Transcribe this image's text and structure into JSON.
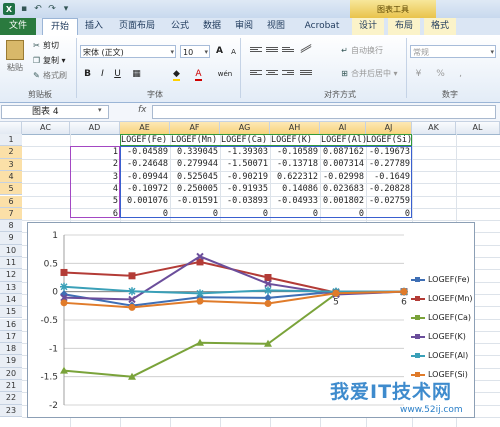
{
  "app": {
    "title_bar": {
      "logo": "X",
      "context_tab_title": "图表工具"
    },
    "tabs": [
      {
        "label": "文件"
      },
      {
        "label": "开始"
      },
      {
        "label": "插入"
      },
      {
        "label": "页面布局"
      },
      {
        "label": "公式"
      },
      {
        "label": "数据"
      },
      {
        "label": "审阅"
      },
      {
        "label": "视图"
      },
      {
        "label": "Acrobat"
      },
      {
        "label": "设计"
      },
      {
        "label": "布局"
      },
      {
        "label": "格式"
      }
    ]
  },
  "ribbon": {
    "clipboard": {
      "paste": "粘贴",
      "cut": "剪切",
      "copy": "复制 ▾",
      "format_painter": "格式刷",
      "group_label": "剪贴板"
    },
    "font": {
      "font_name": "宋体 (正文)",
      "font_size": "10",
      "grow": "A",
      "shrink": "A",
      "bold": "B",
      "italic": "I",
      "underline": "U",
      "wen": "wén",
      "group_label": "字体"
    },
    "alignment": {
      "wrap": "自动换行",
      "merge": "合并后居中 ▾",
      "group_label": "对齐方式"
    },
    "number": {
      "format": "常规",
      "group_label": "数字"
    }
  },
  "formula_bar": {
    "name_box": "图表 4",
    "fx": "fx",
    "value": ""
  },
  "columns": [
    "AC",
    "AD",
    "AE",
    "AF",
    "AG",
    "AH",
    "AI",
    "AJ",
    "AK",
    "AL"
  ],
  "rows": [
    "1",
    "2",
    "3",
    "4",
    "5",
    "6",
    "7",
    "8",
    "9",
    "10",
    "11",
    "12",
    "13",
    "14",
    "15",
    "16",
    "17",
    "18",
    "19",
    "20",
    "21",
    "22",
    "23"
  ],
  "table": {
    "headers": [
      "LOGEF(Fe)",
      "LOGEF(Mn)",
      "LOGEF(Ca)",
      "LOGEF(K)",
      "LOGEF(Al)",
      "LOGEF(Si)"
    ],
    "rows": [
      {
        "idx": "1",
        "v": [
          "-0.04589",
          "0.339045",
          "-1.39303",
          "-0.10589",
          "0.087162",
          "-0.19673"
        ]
      },
      {
        "idx": "2",
        "v": [
          "-0.24648",
          "0.279944",
          "-1.50071",
          "-0.13718",
          "0.007314",
          "-0.27789"
        ]
      },
      {
        "idx": "3",
        "v": [
          "-0.09944",
          "0.525045",
          "-0.90219",
          "0.622312",
          "-0.02998",
          "-0.1649"
        ]
      },
      {
        "idx": "4",
        "v": [
          "-0.10972",
          "0.250005",
          "-0.91935",
          "0.14086",
          "0.023683",
          "-0.20828"
        ]
      },
      {
        "idx": "5",
        "v": [
          "0.001076",
          "-0.01591",
          "-0.03893",
          "-0.04933",
          "0.001802",
          "-0.02759"
        ]
      },
      {
        "idx": "6",
        "v": [
          "0",
          "0",
          "0",
          "0",
          "0",
          "0"
        ]
      }
    ]
  },
  "chart_data": {
    "type": "line",
    "categories": [
      "1",
      "2",
      "3",
      "4",
      "5",
      "6"
    ],
    "ylim": [
      -2,
      1
    ],
    "yticks": [
      "1",
      "0.5",
      "0",
      "-0.5",
      "-1",
      "-1.5",
      "-2"
    ],
    "xtick_labels": [
      "1",
      "3",
      "5",
      "6"
    ],
    "legend_position": "right",
    "series": [
      {
        "name": "LOGEF(Fe)",
        "color": "#3f6fb5",
        "marker": "diamond",
        "values": [
          -0.04589,
          -0.24648,
          -0.09944,
          -0.10972,
          0.001076,
          0
        ]
      },
      {
        "name": "LOGEF(Mn)",
        "color": "#b33b36",
        "marker": "square",
        "values": [
          0.339045,
          0.279944,
          0.525045,
          0.250005,
          -0.01591,
          0
        ]
      },
      {
        "name": "LOGEF(Ca)",
        "color": "#7aa33a",
        "marker": "triangle",
        "values": [
          -1.39303,
          -1.50071,
          -0.90219,
          -0.91935,
          -0.03893,
          0
        ]
      },
      {
        "name": "LOGEF(K)",
        "color": "#6b4e9b",
        "marker": "x",
        "values": [
          -0.10589,
          -0.13718,
          0.622312,
          0.14086,
          -0.04933,
          0
        ]
      },
      {
        "name": "LOGEF(Al)",
        "color": "#3aa0b8",
        "marker": "star",
        "values": [
          0.087162,
          0.007314,
          -0.02998,
          0.023683,
          0.001802,
          0
        ]
      },
      {
        "name": "LOGEF(Si)",
        "color": "#e07b2a",
        "marker": "circle",
        "values": [
          -0.19673,
          -0.27789,
          -0.1649,
          -0.20828,
          -0.02759,
          0
        ]
      }
    ]
  },
  "watermark": {
    "main": "我爱IT技术网",
    "url": "www.52ij.com"
  }
}
